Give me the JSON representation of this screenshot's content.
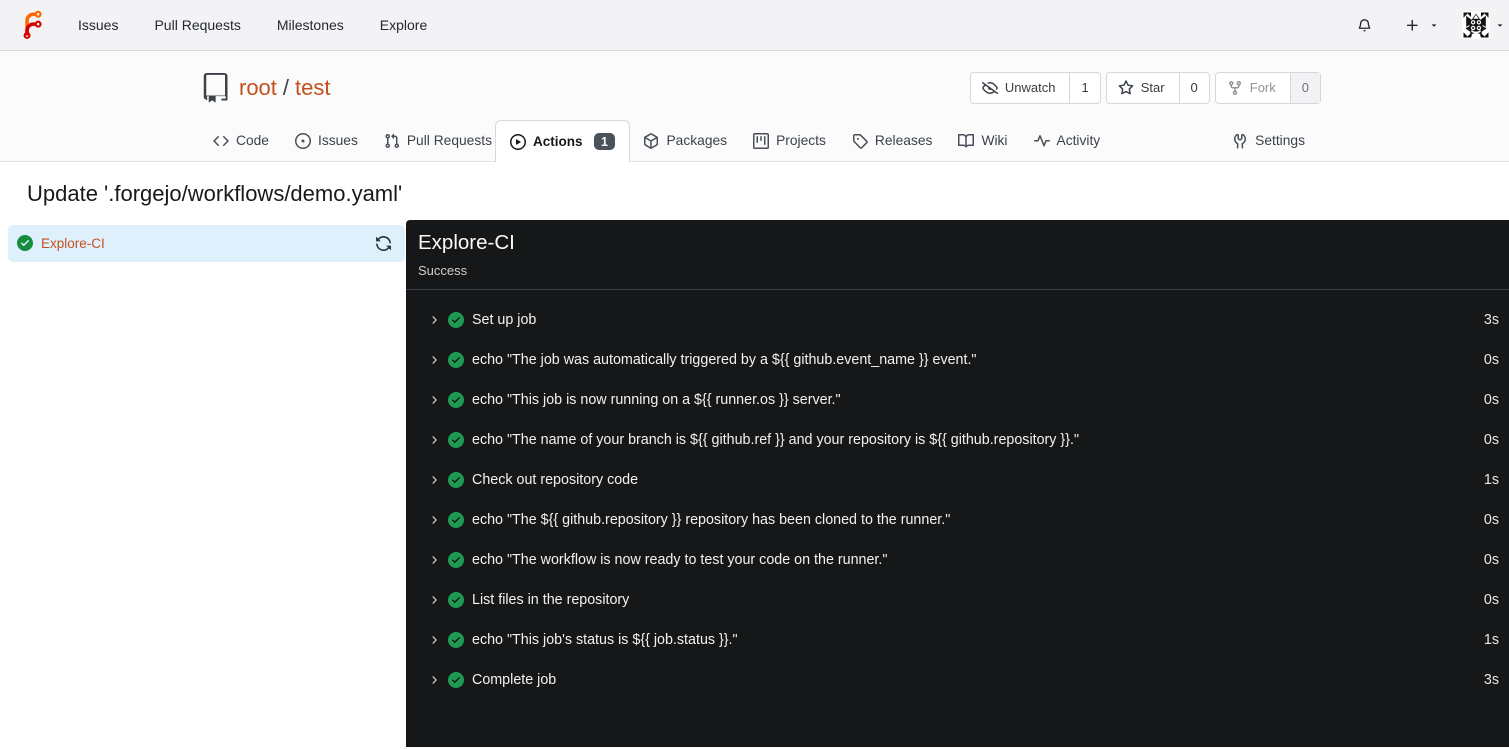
{
  "nav": {
    "items": [
      "Issues",
      "Pull Requests",
      "Milestones",
      "Explore"
    ]
  },
  "repo": {
    "owner": "root",
    "separator": "/",
    "name": "test",
    "buttons": {
      "unwatch": {
        "label": "Unwatch",
        "count": "1"
      },
      "star": {
        "label": "Star",
        "count": "0"
      },
      "fork": {
        "label": "Fork",
        "count": "0"
      }
    }
  },
  "tabs": {
    "code": "Code",
    "issues": "Issues",
    "pulls": "Pull Requests",
    "actions": {
      "label": "Actions",
      "badge": "1"
    },
    "packages": "Packages",
    "projects": "Projects",
    "releases": "Releases",
    "wiki": "Wiki",
    "activity": "Activity",
    "settings": "Settings"
  },
  "page": {
    "heading": "Update '.forgejo/workflows/demo.yaml'"
  },
  "sidebar": {
    "job": {
      "name": "Explore-CI"
    }
  },
  "run": {
    "title": "Explore-CI",
    "status": "Success",
    "steps": [
      {
        "name": "Set up job",
        "duration": "3s"
      },
      {
        "name": "echo \"The job was automatically triggered by a ${{ github.event_name }} event.\"",
        "duration": "0s"
      },
      {
        "name": "echo \"This job is now running on a ${{ runner.os }} server.\"",
        "duration": "0s"
      },
      {
        "name": "echo \"The name of your branch is ${{ github.ref }} and your repository is ${{ github.repository }}.\"",
        "duration": "0s"
      },
      {
        "name": "Check out repository code",
        "duration": "1s"
      },
      {
        "name": "echo \"The ${{ github.repository }} repository has been cloned to the runner.\"",
        "duration": "0s"
      },
      {
        "name": "echo \"The workflow is now ready to test your code on the runner.\"",
        "duration": "0s"
      },
      {
        "name": "List files in the repository",
        "duration": "0s"
      },
      {
        "name": "echo \"This job's status is ${{ job.status }}.\"",
        "duration": "1s"
      },
      {
        "name": "Complete job",
        "duration": "3s"
      }
    ]
  },
  "colors": {
    "accent_link": "#c5501d",
    "success_green_sidebar": "#188c3e",
    "success_green_console": "#1e9b52",
    "console_bg": "#161718",
    "selected_job_bg": "#dff0fd",
    "badge_bg": "#4a525c"
  }
}
